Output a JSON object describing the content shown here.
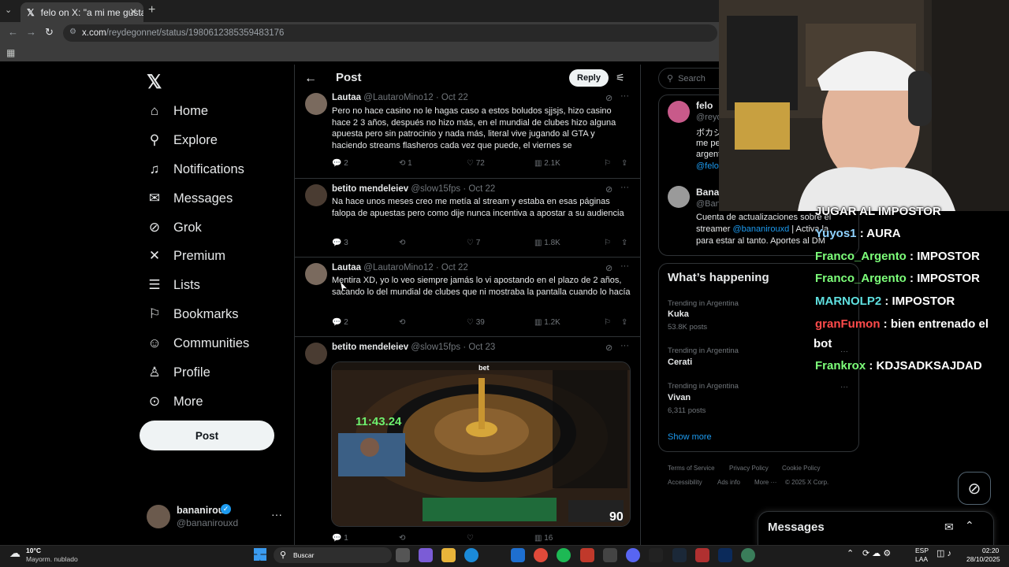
{
  "browser": {
    "tab_title": "felo on X: \"a mi me gusta que e",
    "url_domain": "x.com",
    "url_path": "/reydegonnet/status/1980612385359483176"
  },
  "nav": {
    "items": [
      {
        "label": "Home",
        "icon": "home-icon"
      },
      {
        "label": "Explore",
        "icon": "search-icon"
      },
      {
        "label": "Notifications",
        "icon": "bell-icon"
      },
      {
        "label": "Messages",
        "icon": "envelope-icon"
      },
      {
        "label": "Grok",
        "icon": "grok-icon"
      },
      {
        "label": "Premium",
        "icon": "x-icon"
      },
      {
        "label": "Lists",
        "icon": "list-icon"
      },
      {
        "label": "Bookmarks",
        "icon": "bookmark-icon"
      },
      {
        "label": "Communities",
        "icon": "people-icon"
      },
      {
        "label": "Profile",
        "icon": "person-icon"
      },
      {
        "label": "More",
        "icon": "more-circle-icon"
      }
    ],
    "post_label": "Post"
  },
  "account": {
    "name": "bananirou",
    "handle": "@bananirouxd"
  },
  "header": {
    "title": "Post",
    "reply_label": "Reply"
  },
  "tweets": [
    {
      "name": "Lautaa",
      "handle": "@LautaroMino12",
      "date": "· Oct 22",
      "text": "Pero no hace casino no le hagas caso a estos boludos sjjsjs, hizo casino hace 2 3 años, después no hizo más, en el mundial de clubes hizo alguna apuesta pero sin patrocinio y nada más, literal vive jugando al GTA y haciendo streams flasheros cada vez que puede, el viernes se",
      "replies": "2",
      "reposts": "1",
      "likes": "72",
      "views": "2.1K"
    },
    {
      "name": "betito mendeleiev",
      "handle": "@slow15fps",
      "date": "· Oct 22",
      "text": "Na hace unos meses creo me metía al stream y estaba en esas páginas falopa de apuestas pero como dije nunca incentiva a apostar a su audiencia",
      "replies": "3",
      "reposts": "",
      "likes": "7",
      "views": "1.8K"
    },
    {
      "name": "Lautaa",
      "handle": "@LautaroMino12",
      "date": "· Oct 22",
      "text": "Mentira XD, yo lo veo siempre jamás lo vi apostando en el plazo de 2 años, sacando lo del mundial de clubes que ni mostraba la pantalla cuando lo hacía",
      "replies": "2",
      "reposts": "",
      "likes": "39",
      "views": "1.2K"
    },
    {
      "name": "betito mendeleiev",
      "handle": "@slow15fps",
      "date": "· Oct 23",
      "text": "",
      "replies": "1",
      "reposts": "",
      "likes": "",
      "views": "16"
    }
  ],
  "media": {
    "timer": "11:43.24",
    "corner_number": "90",
    "brand_label": "bet"
  },
  "right": {
    "search_placeholder": "Search",
    "who": [
      {
        "name": "felo",
        "handle": "@reyd",
        "line1": "ボカジ",
        "line2": "me pe",
        "line3": "argent",
        "line4": "@felo"
      },
      {
        "name": "Banan",
        "handle": "@Ban",
        "bio1": "Cuenta de actualizaciones sobre el",
        "bio2a": "streamer ",
        "bio2link": "@bananirouxd",
        "bio2b": " | Activa la",
        "bio3": "para estar al tanto. Aportes al DM"
      }
    ],
    "trends_title": "What’s happening",
    "trends": [
      {
        "meta": "Trending in Argentina",
        "name": "Kuka",
        "count": "53.8K posts"
      },
      {
        "meta": "Trending in Argentina",
        "name": "Cerati",
        "count": ""
      },
      {
        "meta": "Trending in Argentina",
        "name": "Vivan",
        "count": "6,311 posts"
      }
    ],
    "show_more": "Show more",
    "footer": [
      "Terms of Service",
      "Privacy Policy",
      "Cookie Policy",
      "Accessibility",
      "Ads info",
      "More ···",
      "© 2025 X Corp."
    ]
  },
  "chat": {
    "header": "JUGAR AL IMPOSTOR",
    "lines": [
      {
        "user": "Yuyos1",
        "color": "#8fd3ff",
        "msg": " : AURA"
      },
      {
        "user": "Franco_Argento",
        "color": "#7dff7a",
        "msg": " : IMPOSTOR"
      },
      {
        "user": "Franco_Argento",
        "color": "#7dff7a",
        "msg": " : IMPOSTOR"
      },
      {
        "user": "MARNOLP2",
        "color": "#5fe0e0",
        "msg": " : IMPOSTOR"
      },
      {
        "user": "granFumon",
        "color": "#ff4b4b",
        "msg": " : bien entrenado el"
      },
      {
        "user": "",
        "color": "#ffffff",
        "msg": "bot"
      },
      {
        "user": "Frankrox",
        "color": "#7dff7a",
        "msg": " : KDJSADKSAJDAD"
      }
    ]
  },
  "messages_drawer": {
    "title": "Messages"
  },
  "taskbar": {
    "weather_temp": "10°C",
    "weather_desc": "Mayorm. nublado",
    "search_label": "Buscar",
    "lang1": "ESP",
    "lang2": "LAA",
    "time": "02:20",
    "date": "28/10/2025"
  }
}
